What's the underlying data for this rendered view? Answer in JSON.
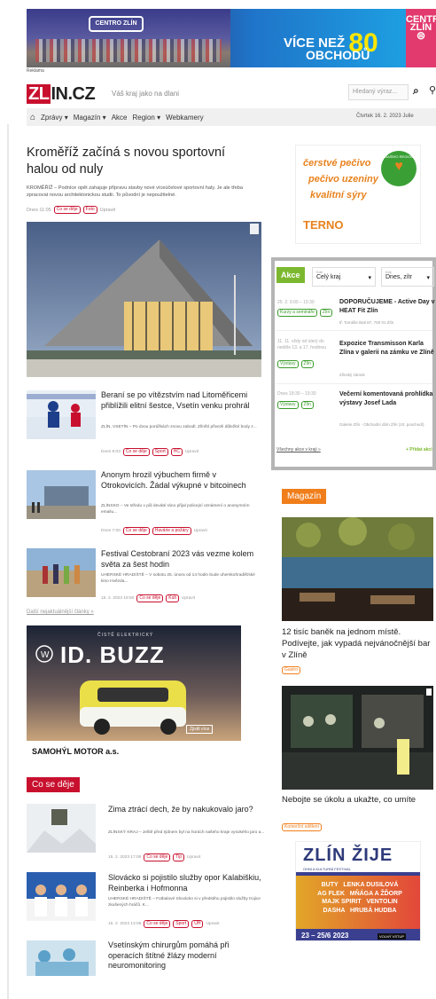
{
  "banner": {
    "logo_text": "CENTRO ZLÍN",
    "headline_pre": "VÍCE NEŽ",
    "headline_num": "80",
    "headline_post": "OBCHODŮ",
    "badge_top": "CENTRO",
    "badge_main": "ZLÍN",
    "label": "Reklama"
  },
  "header": {
    "logo_prefix": "ZL",
    "logo_suffix": "IN.CZ",
    "tagline": "Váš kraj jako na dlani",
    "search_placeholder": "Hledaný výraz..."
  },
  "nav": {
    "items": [
      "Zprávy",
      "Magazín",
      "Akce",
      "Region",
      "Webkamery"
    ],
    "date": "Čtvrtek 16. 2. 2023 Julie"
  },
  "main": {
    "title": "Kroměříž začíná s novou sportovní halou od nuly",
    "perex": "KROMĚŘÍŽ – Podníce opět zahajuje přípravu stavby nové víceúčelové sportovní haly. Je ale třeba zpracovat novou architektonickou studii. To původní je nepoužitelné.",
    "meta_time": "Dnes 11:05",
    "tags": [
      "Co se děje",
      "Foto"
    ],
    "edit": "Upravit"
  },
  "articles": [
    {
      "title": "Beraní se po vítězstvím nad Litoměřicemi přiblížili elitní šestce, Vsetín venku prohrál",
      "perex": "ZLÍN, VSETÍN – Po dvou porážkách znovu zabodl, Zlínští přivezli důležité body z...",
      "meta": "Dnes 9:03",
      "tags": [
        "Co se děje",
        "Sport",
        "HC"
      ],
      "edit": "Upravit"
    },
    {
      "title": "Anonym hrozil výbuchem firmě v Otrokovicích. Žádal výkupné v bitcoinech",
      "perex": "ZLÍNSKO – Ve středu v půl deváté ráno přijal policejní oznámení o anonymním emailu...",
      "meta": "Dnes 7:00",
      "tags": [
        "Co se děje",
        "Havárie a požáry"
      ],
      "edit": "Upravit"
    },
    {
      "title": "Festival Cestobraní 2023 vás vezme kolem světa za šest hodin",
      "perex": "UHERSKÉ HRADIŠTĚ – V sobotu 25. února od 14 hodin bude uherskohradišťské kino Hvězda...",
      "meta": "15. 2. 2023 18:50",
      "tags": [
        "Co se děje",
        "Kult"
      ],
      "edit": "Upravit"
    }
  ],
  "more_link": "Další nejaktuálnější články »",
  "car_ad": {
    "top": "ČISTĚ ELEKTRICKÝ",
    "model": "ID. BUZZ",
    "cta": "Zjistit více",
    "dealer": "SAMOHÝL MOTOR a.s."
  },
  "co_se_deje": {
    "heading": "Co se děje",
    "items": [
      {
        "title": "Zima ztrácí dech, že by nakukovalo jaro?",
        "perex": "ZLÍNSKÝ KRAJ – Ještě před týdnem byl na horách našeho kraje vysokého jaro a...",
        "meta": "15. 2. 2023 17:06",
        "tags": [
          "Co se děje",
          "Tip"
        ],
        "edit": "Upravit"
      },
      {
        "title": "Slovácko si pojistilo služby opor Kalabiškiu, Reinberka i Hofmonna",
        "perex": "UHERSKÉ HRADIŠTĚ – Fotbalové Slovácko si v předstihu pojistilo služby trojice zkušených hráčů. K...",
        "meta": "15. 2. 2023 13:08",
        "tags": [
          "Co se děje",
          "Sport",
          "UH"
        ],
        "edit": "Upravit"
      },
      {
        "title": "Vsetínským chirurgům pomáhá při operacích štítné žlázy moderní neuromonitoring",
        "perex": "",
        "meta": "",
        "tags": [],
        "edit": ""
      }
    ]
  },
  "pecivo_ad": {
    "l1": "čerstvé pečivo",
    "l2": "pečivo uzeniny",
    "l3": "kvalitní sýry",
    "brand": "TERNO",
    "seal": "Z NAŠÍHO REGIONU"
  },
  "akce": {
    "button": "Akce",
    "filter1_label": "Kde",
    "filter1": "Celý kraj",
    "filter2_label": "Kdy",
    "filter2": "Dnes, zítr",
    "events": [
      {
        "time": "25. 2. 9:00 – 15:30",
        "tags": [
          "Kurzy a semináře",
          "Zlín"
        ],
        "title": "DOPORUČUJEME - Active Day v HEAT Fit Zlín",
        "place": "tř. Tomáše Bati 87, 760 01 Zlín"
      },
      {
        "time": "11. 11. vždy od úterý do neděle 13. a 17. hodinou",
        "tags": [
          "Výstavy",
          "Zlín"
        ],
        "title": "Expozice Transmisson Karla Zlína v galerii na zámku ve Zlíně",
        "place": "Zlínský zámek"
      },
      {
        "time": "Dnes 18:30 – 19:30",
        "tags": [
          "Výstavy",
          "Zlín"
        ],
        "title": "Večerní komentovaná prohlídka výstavy Josef Lada",
        "place": "Galerie Zlín - Obchodní dům Zlín (10. poschodí)"
      }
    ],
    "all": "Všechny akce v kraji »",
    "add": "+ Přidat akci"
  },
  "magazin": {
    "heading": "Magazín",
    "items": [
      {
        "title": "12 tisíc baněk na jednom místě. Podívejte, jak vypadá nejvánočnější bar v Zlíně",
        "tag": "Gastro"
      },
      {
        "title": "Nebojte se úkolu a ukažte, co umíte",
        "tag": "Komerční sdělení"
      }
    ]
  },
  "zlin_ad": {
    "title": "ZLÍN ŽIJE",
    "sub": "OHNI A KULTURNÍ FESTIVAL",
    "names": [
      "BUTY",
      "LENKA DUSILOVÁ",
      "AG FLEK",
      "MŇÁGA A ŽĎORP",
      "MAJK SPIRIT",
      "VENTOLIN",
      "DASHA",
      "HRUBÁ HUDBA"
    ],
    "dates": "23 – 25/6 2023",
    "label": "VOLNÝ VSTUP"
  },
  "colors": {
    "brand_red": "#c8102e",
    "akce_green": "#7cb82f",
    "magazin_orange": "#f07e1b"
  }
}
